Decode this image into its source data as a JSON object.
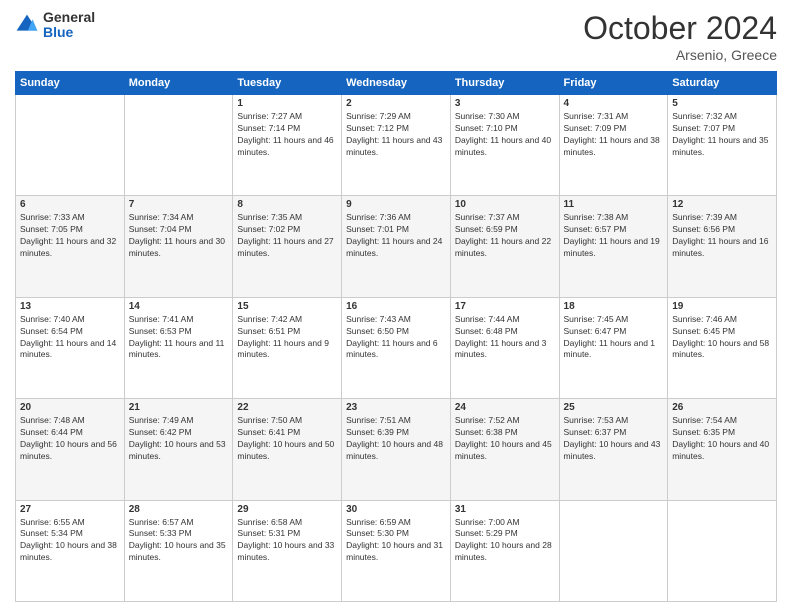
{
  "logo": {
    "general": "General",
    "blue": "Blue"
  },
  "header": {
    "month": "October 2024",
    "location": "Arsenio, Greece"
  },
  "weekdays": [
    "Sunday",
    "Monday",
    "Tuesday",
    "Wednesday",
    "Thursday",
    "Friday",
    "Saturday"
  ],
  "weeks": [
    [
      {
        "day": "",
        "sunrise": "",
        "sunset": "",
        "daylight": ""
      },
      {
        "day": "",
        "sunrise": "",
        "sunset": "",
        "daylight": ""
      },
      {
        "day": "1",
        "sunrise": "Sunrise: 7:27 AM",
        "sunset": "Sunset: 7:14 PM",
        "daylight": "Daylight: 11 hours and 46 minutes."
      },
      {
        "day": "2",
        "sunrise": "Sunrise: 7:29 AM",
        "sunset": "Sunset: 7:12 PM",
        "daylight": "Daylight: 11 hours and 43 minutes."
      },
      {
        "day": "3",
        "sunrise": "Sunrise: 7:30 AM",
        "sunset": "Sunset: 7:10 PM",
        "daylight": "Daylight: 11 hours and 40 minutes."
      },
      {
        "day": "4",
        "sunrise": "Sunrise: 7:31 AM",
        "sunset": "Sunset: 7:09 PM",
        "daylight": "Daylight: 11 hours and 38 minutes."
      },
      {
        "day": "5",
        "sunrise": "Sunrise: 7:32 AM",
        "sunset": "Sunset: 7:07 PM",
        "daylight": "Daylight: 11 hours and 35 minutes."
      }
    ],
    [
      {
        "day": "6",
        "sunrise": "Sunrise: 7:33 AM",
        "sunset": "Sunset: 7:05 PM",
        "daylight": "Daylight: 11 hours and 32 minutes."
      },
      {
        "day": "7",
        "sunrise": "Sunrise: 7:34 AM",
        "sunset": "Sunset: 7:04 PM",
        "daylight": "Daylight: 11 hours and 30 minutes."
      },
      {
        "day": "8",
        "sunrise": "Sunrise: 7:35 AM",
        "sunset": "Sunset: 7:02 PM",
        "daylight": "Daylight: 11 hours and 27 minutes."
      },
      {
        "day": "9",
        "sunrise": "Sunrise: 7:36 AM",
        "sunset": "Sunset: 7:01 PM",
        "daylight": "Daylight: 11 hours and 24 minutes."
      },
      {
        "day": "10",
        "sunrise": "Sunrise: 7:37 AM",
        "sunset": "Sunset: 6:59 PM",
        "daylight": "Daylight: 11 hours and 22 minutes."
      },
      {
        "day": "11",
        "sunrise": "Sunrise: 7:38 AM",
        "sunset": "Sunset: 6:57 PM",
        "daylight": "Daylight: 11 hours and 19 minutes."
      },
      {
        "day": "12",
        "sunrise": "Sunrise: 7:39 AM",
        "sunset": "Sunset: 6:56 PM",
        "daylight": "Daylight: 11 hours and 16 minutes."
      }
    ],
    [
      {
        "day": "13",
        "sunrise": "Sunrise: 7:40 AM",
        "sunset": "Sunset: 6:54 PM",
        "daylight": "Daylight: 11 hours and 14 minutes."
      },
      {
        "day": "14",
        "sunrise": "Sunrise: 7:41 AM",
        "sunset": "Sunset: 6:53 PM",
        "daylight": "Daylight: 11 hours and 11 minutes."
      },
      {
        "day": "15",
        "sunrise": "Sunrise: 7:42 AM",
        "sunset": "Sunset: 6:51 PM",
        "daylight": "Daylight: 11 hours and 9 minutes."
      },
      {
        "day": "16",
        "sunrise": "Sunrise: 7:43 AM",
        "sunset": "Sunset: 6:50 PM",
        "daylight": "Daylight: 11 hours and 6 minutes."
      },
      {
        "day": "17",
        "sunrise": "Sunrise: 7:44 AM",
        "sunset": "Sunset: 6:48 PM",
        "daylight": "Daylight: 11 hours and 3 minutes."
      },
      {
        "day": "18",
        "sunrise": "Sunrise: 7:45 AM",
        "sunset": "Sunset: 6:47 PM",
        "daylight": "Daylight: 11 hours and 1 minute."
      },
      {
        "day": "19",
        "sunrise": "Sunrise: 7:46 AM",
        "sunset": "Sunset: 6:45 PM",
        "daylight": "Daylight: 10 hours and 58 minutes."
      }
    ],
    [
      {
        "day": "20",
        "sunrise": "Sunrise: 7:48 AM",
        "sunset": "Sunset: 6:44 PM",
        "daylight": "Daylight: 10 hours and 56 minutes."
      },
      {
        "day": "21",
        "sunrise": "Sunrise: 7:49 AM",
        "sunset": "Sunset: 6:42 PM",
        "daylight": "Daylight: 10 hours and 53 minutes."
      },
      {
        "day": "22",
        "sunrise": "Sunrise: 7:50 AM",
        "sunset": "Sunset: 6:41 PM",
        "daylight": "Daylight: 10 hours and 50 minutes."
      },
      {
        "day": "23",
        "sunrise": "Sunrise: 7:51 AM",
        "sunset": "Sunset: 6:39 PM",
        "daylight": "Daylight: 10 hours and 48 minutes."
      },
      {
        "day": "24",
        "sunrise": "Sunrise: 7:52 AM",
        "sunset": "Sunset: 6:38 PM",
        "daylight": "Daylight: 10 hours and 45 minutes."
      },
      {
        "day": "25",
        "sunrise": "Sunrise: 7:53 AM",
        "sunset": "Sunset: 6:37 PM",
        "daylight": "Daylight: 10 hours and 43 minutes."
      },
      {
        "day": "26",
        "sunrise": "Sunrise: 7:54 AM",
        "sunset": "Sunset: 6:35 PM",
        "daylight": "Daylight: 10 hours and 40 minutes."
      }
    ],
    [
      {
        "day": "27",
        "sunrise": "Sunrise: 6:55 AM",
        "sunset": "Sunset: 5:34 PM",
        "daylight": "Daylight: 10 hours and 38 minutes."
      },
      {
        "day": "28",
        "sunrise": "Sunrise: 6:57 AM",
        "sunset": "Sunset: 5:33 PM",
        "daylight": "Daylight: 10 hours and 35 minutes."
      },
      {
        "day": "29",
        "sunrise": "Sunrise: 6:58 AM",
        "sunset": "Sunset: 5:31 PM",
        "daylight": "Daylight: 10 hours and 33 minutes."
      },
      {
        "day": "30",
        "sunrise": "Sunrise: 6:59 AM",
        "sunset": "Sunset: 5:30 PM",
        "daylight": "Daylight: 10 hours and 31 minutes."
      },
      {
        "day": "31",
        "sunrise": "Sunrise: 7:00 AM",
        "sunset": "Sunset: 5:29 PM",
        "daylight": "Daylight: 10 hours and 28 minutes."
      },
      {
        "day": "",
        "sunrise": "",
        "sunset": "",
        "daylight": ""
      },
      {
        "day": "",
        "sunrise": "",
        "sunset": "",
        "daylight": ""
      }
    ]
  ]
}
